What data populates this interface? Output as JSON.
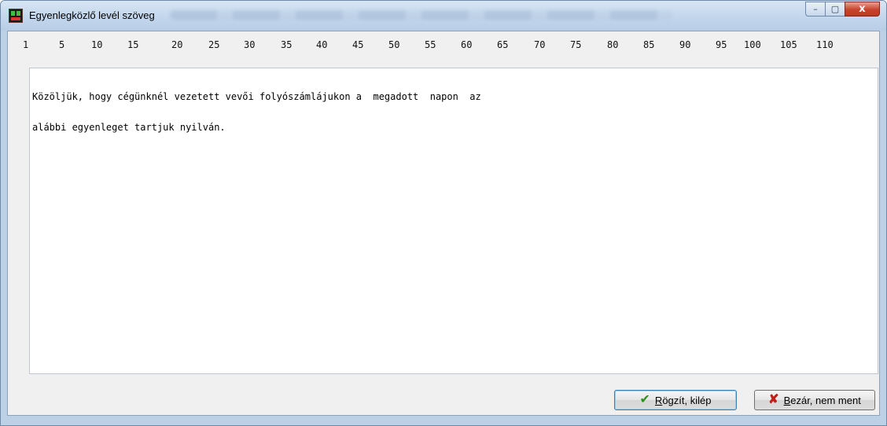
{
  "window": {
    "title": "Egyenlegközlő levél szöveg",
    "controls": {
      "minimize": "–",
      "maximize": "▢",
      "close": "x"
    }
  },
  "ruler": {
    "marks": [
      "1",
      "5",
      "10",
      "15",
      "20",
      "25",
      "30",
      "35",
      "40",
      "45",
      "50",
      "55",
      "60",
      "65",
      "70",
      "75",
      "80",
      "85",
      "90",
      "95",
      "100",
      "105",
      "110"
    ]
  },
  "editor": {
    "lines": [
      "Közöljük, hogy cégünknél vezetett vevői folyószámlájukon a  megadott  napon  az",
      "alábbi egyenleget tartjuk nyilván."
    ]
  },
  "buttons": {
    "save": {
      "first_letter": "R",
      "rest": "ögzít, kilép",
      "icon": "check-icon"
    },
    "close": {
      "first_letter": "B",
      "rest": "ezár, nem ment",
      "icon": "cross-icon"
    }
  },
  "colors": {
    "check_icon": "#2f8f1f",
    "cross_icon": "#c0201a",
    "close_button": "#c8432c"
  }
}
